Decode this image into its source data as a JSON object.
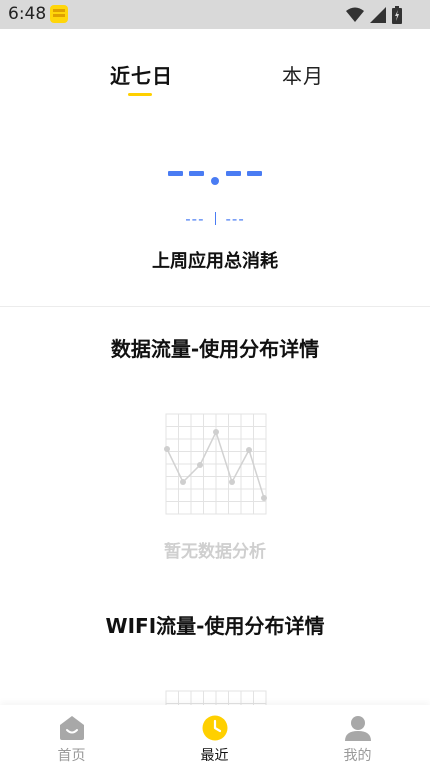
{
  "status_bar": {
    "time": "6:48"
  },
  "tabs": [
    {
      "label": "近七日",
      "active": true
    },
    {
      "label": "本月",
      "active": false
    }
  ],
  "summary": {
    "sub_left": "---",
    "sub_right": "---",
    "title": "上周应用总消耗"
  },
  "sections": [
    {
      "title": "数据流量-使用分布详情",
      "empty_text": "暂无数据分析"
    },
    {
      "title": "WIFI流量-使用分布详情"
    }
  ],
  "bottom_nav": [
    {
      "label": "首页",
      "icon": "home-icon",
      "active": false
    },
    {
      "label": "最近",
      "icon": "clock-icon",
      "active": true
    },
    {
      "label": "我的",
      "icon": "person-icon",
      "active": false
    }
  ],
  "colors": {
    "accent_blue": "#4a7cf3",
    "accent_yellow": "#ffd000",
    "status_bar_bg": "#d9d9d9",
    "muted_text": "#cfcfcf"
  }
}
